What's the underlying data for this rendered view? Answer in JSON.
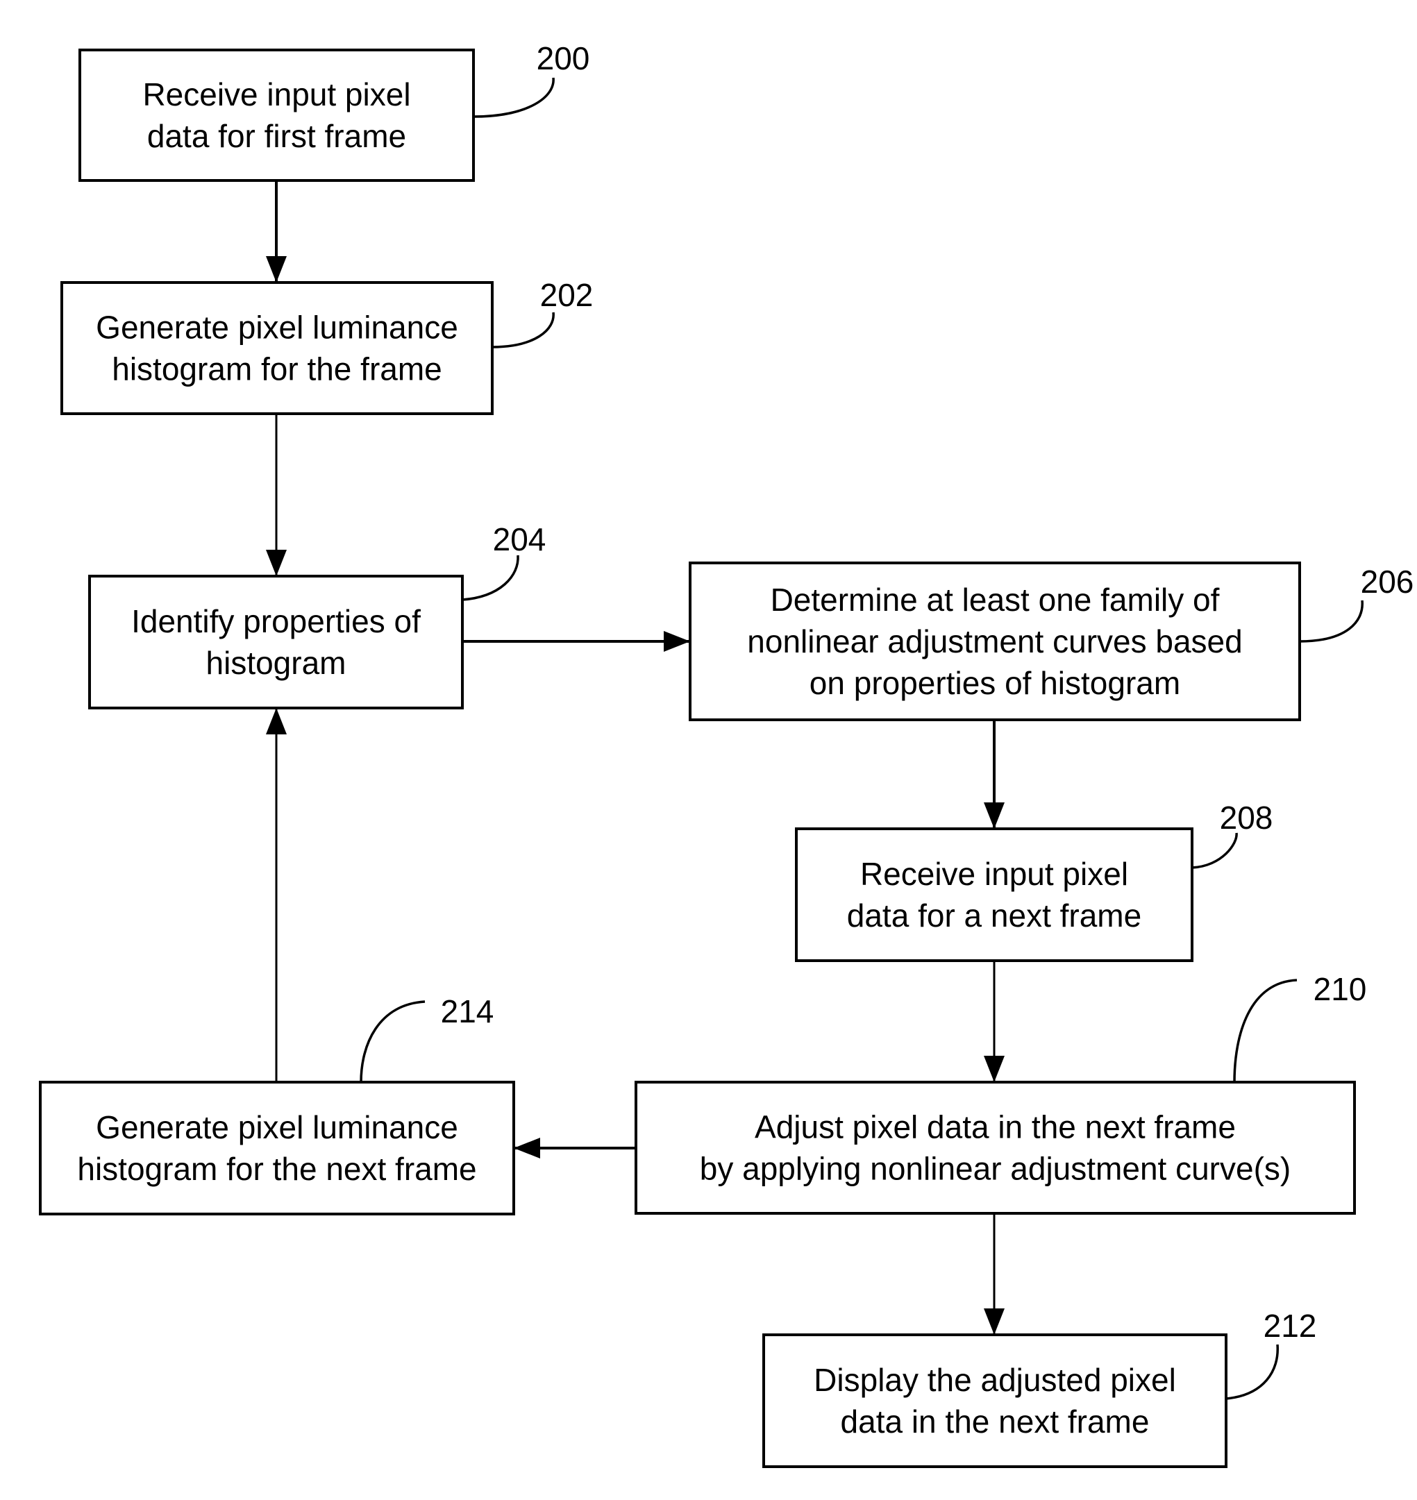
{
  "diagram": {
    "type": "flowchart",
    "steps": [
      {
        "id": "200",
        "ref": "200",
        "lines": [
          "Receive input pixel",
          "data for first frame"
        ]
      },
      {
        "id": "202",
        "ref": "202",
        "lines": [
          "Generate pixel luminance",
          "histogram for the frame"
        ]
      },
      {
        "id": "204",
        "ref": "204",
        "lines": [
          "Identify properties of",
          "histogram"
        ]
      },
      {
        "id": "206",
        "ref": "206",
        "lines": [
          "Determine at least one family of",
          "nonlinear adjustment curves based",
          "on properties of histogram"
        ]
      },
      {
        "id": "208",
        "ref": "208",
        "lines": [
          "Receive input pixel",
          "data for a next frame"
        ]
      },
      {
        "id": "210",
        "ref": "210",
        "lines": [
          "Adjust pixel data in the next frame",
          "by applying nonlinear adjustment curve(s)"
        ]
      },
      {
        "id": "212",
        "ref": "212",
        "lines": [
          "Display the adjusted pixel",
          "data in the next frame"
        ]
      },
      {
        "id": "214",
        "ref": "214",
        "lines": [
          "Generate pixel luminance",
          "histogram for the next frame"
        ]
      }
    ],
    "edges": [
      {
        "from": "200",
        "to": "202"
      },
      {
        "from": "202",
        "to": "204"
      },
      {
        "from": "204",
        "to": "206"
      },
      {
        "from": "206",
        "to": "208"
      },
      {
        "from": "208",
        "to": "210"
      },
      {
        "from": "210",
        "to": "212"
      },
      {
        "from": "210",
        "to": "214"
      },
      {
        "from": "214",
        "to": "204"
      }
    ]
  }
}
